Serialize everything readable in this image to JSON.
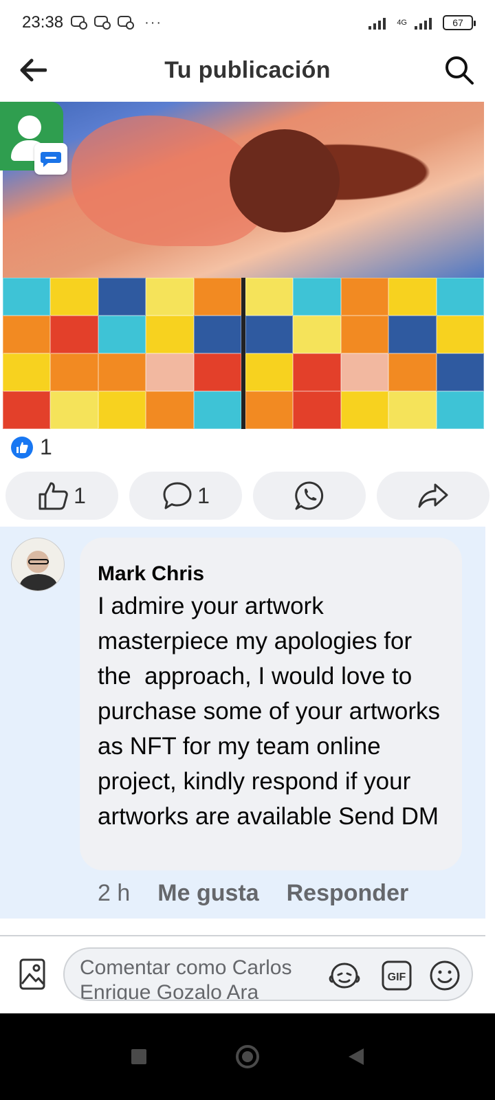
{
  "status_bar": {
    "time": "23:38",
    "overflow": "···",
    "network": "4G",
    "battery": "67"
  },
  "header": {
    "title": "Tu publicación"
  },
  "post": {
    "reaction_count": "1",
    "actions": {
      "like_count": "1",
      "comment_count": "1"
    }
  },
  "comment": {
    "author": "Mark Chris",
    "text": "I admire your artwork masterpiece my apologies for the  approach, I would love to purchase some of your artworks as NFT for my team online project, kindly respond if your artworks are available Send DM",
    "time": "2 h",
    "like_label": "Me gusta",
    "reply_label": "Responder"
  },
  "composer": {
    "placeholder": "Comentar como Carlos Enrique Gozalo Ara"
  },
  "colors": {
    "facebook_blue": "#1877f2",
    "comment_highlight": "#e6f0fc",
    "bubble": "#f0f1f4"
  }
}
